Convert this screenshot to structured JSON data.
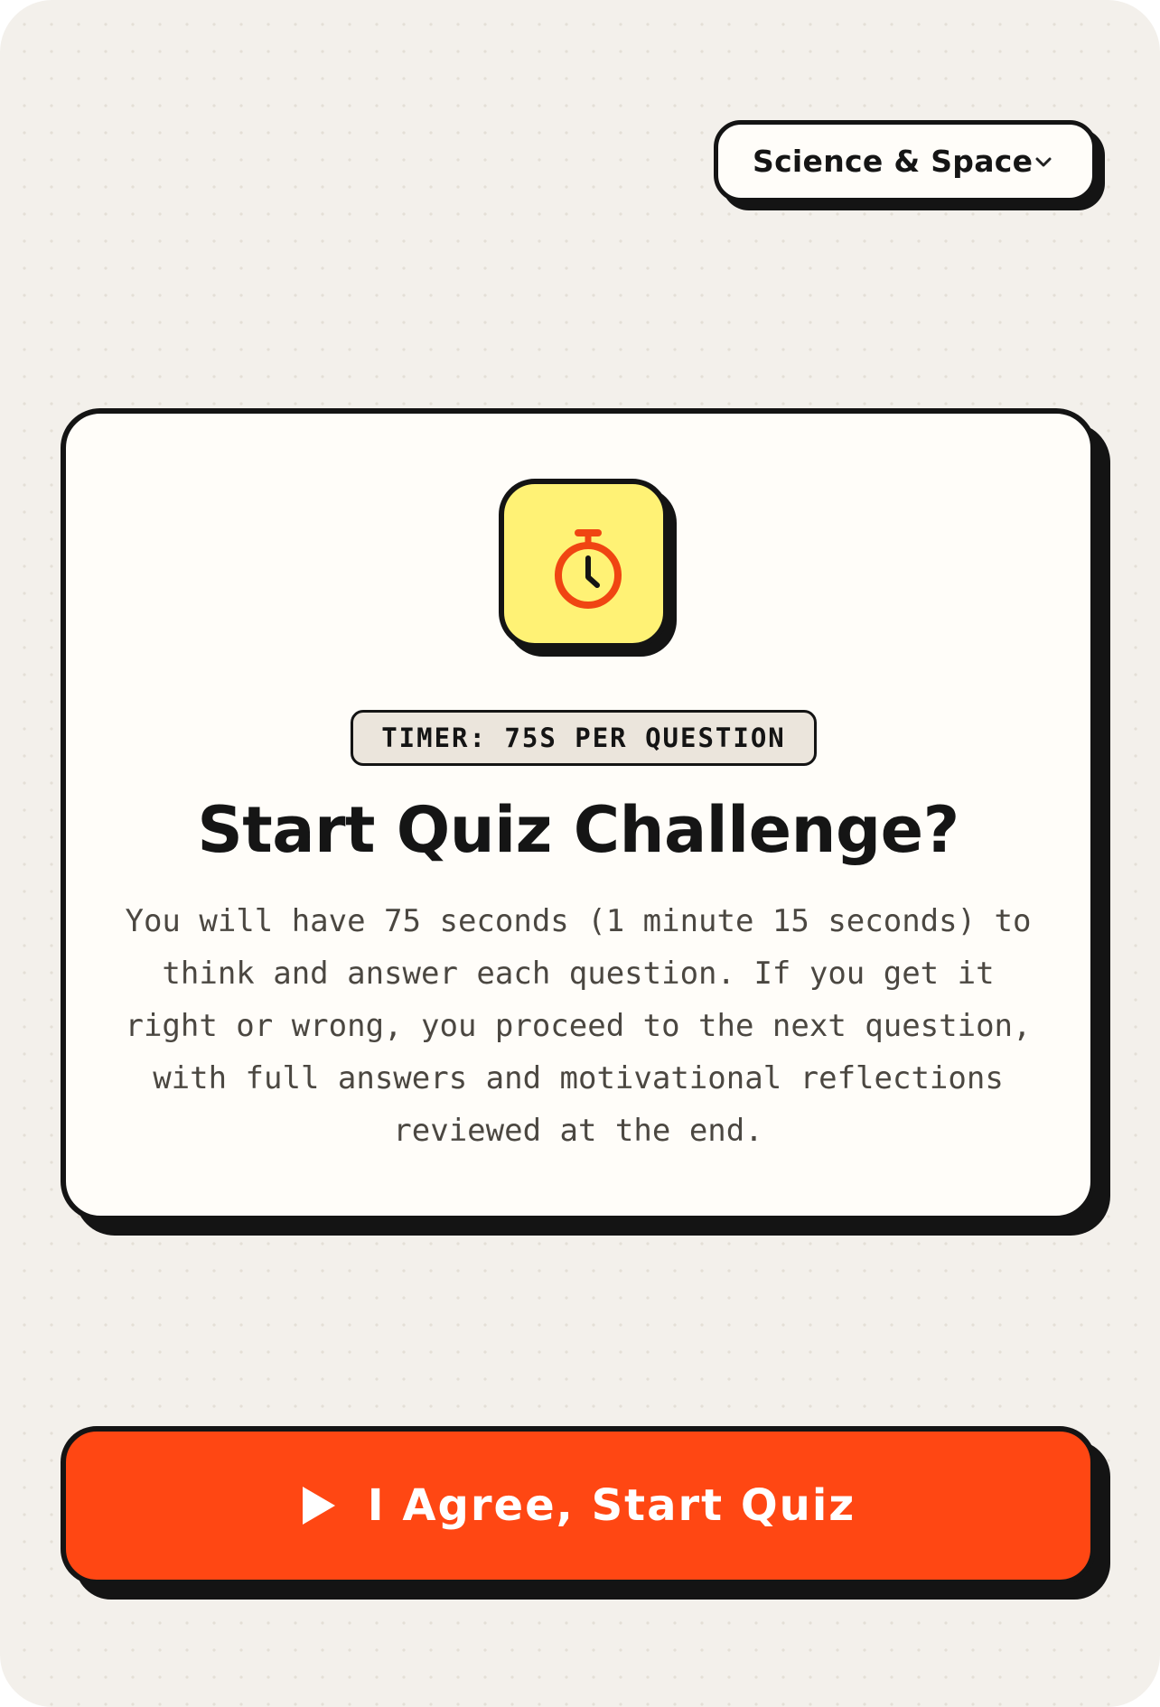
{
  "category": {
    "selected": "Science & Space",
    "icon": "chevron-down-icon"
  },
  "card": {
    "icon": "stopwatch-icon",
    "badge": "TIMER: 75S PER QUESTION",
    "title": "Start Quiz Challenge?",
    "description": "You will have 75 seconds (1 minute 15 seconds) to think and answer each question. If you get it right or wrong, you proceed to the next question, with full answers and motivational reflections reviewed at the end."
  },
  "start_button": {
    "label": "I Agree, Start Quiz",
    "icon": "play-icon"
  },
  "colors": {
    "background": "#f3f0eb",
    "card": "#fffdf9",
    "accent": "#ff4713",
    "icon_tile": "#fff275",
    "ink": "#141414"
  }
}
